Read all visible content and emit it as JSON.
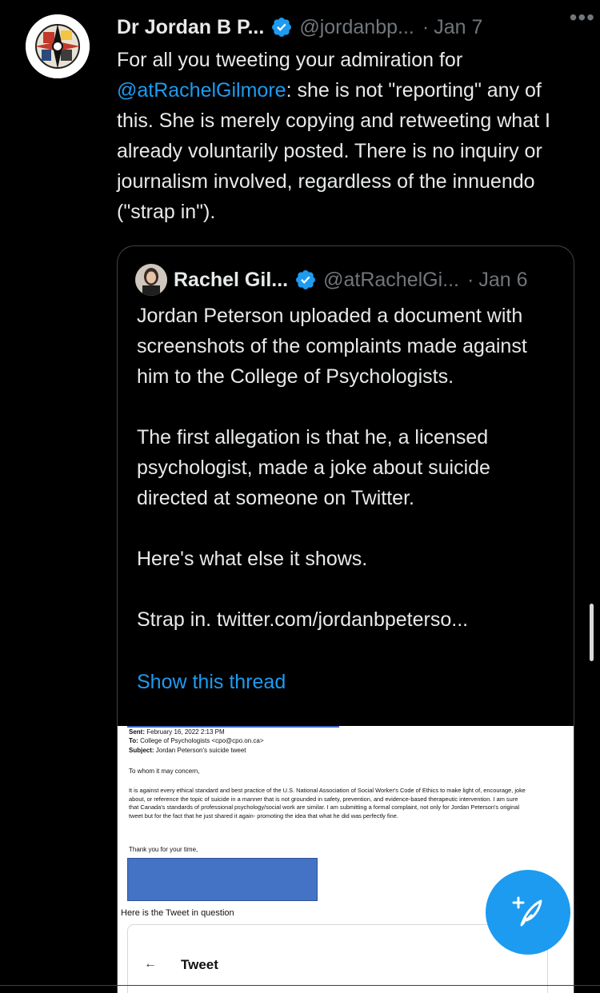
{
  "tweet": {
    "author_name": "Dr Jordan B P...",
    "author_handle": "@jordanbp...",
    "separator": "·",
    "date": "Jan 7",
    "more_label": "•••",
    "text_before_mention": "For all you tweeting your admiration for ",
    "mention": "@atRachelGilmore",
    "text_after_mention": ": she is not \"reporting\" any of this. She is merely copying and retweeting what I already voluntarily posted. There is no inquiry or journalism involved, regardless of the innuendo (\"strap in\")."
  },
  "quote": {
    "author_name": "Rachel Gil...",
    "author_handle": "@atRachelGi...",
    "separator": "·",
    "date": "Jan 6",
    "paragraphs": [
      "Jordan Peterson uploaded a document with screenshots of the complaints made against him to the College of Psychologists.",
      "The first allegation is that he, a licensed psychologist, made a joke about suicide directed at someone on Twitter.",
      "Here's what else it shows.",
      "Strap in.  twitter.com/jordanbpeterso..."
    ],
    "show_thread": "Show this thread"
  },
  "document": {
    "sent_label": "Sent:",
    "sent_value": "February 16, 2022 2:13 PM",
    "to_label": "To:",
    "to_value": "College of Psychologists <cpo@cpo.on.ca>",
    "subject_label": "Subject:",
    "subject_value": "Jordan Peterson's suicide tweet",
    "greeting": "To whom it may concern,",
    "body": "It is against every ethical standard and best practice of the U.S. National Association of Social Worker's Code of Ethics to make light of, encourage, joke about, or reference the topic of suicide in a manner that is not grounded in safety, prevention, and evidence-based therapeutic intervention. I am sure that Canada's standards of professional psychology/social work are similar. I am submitting a formal complaint, not only for Jordan Peterson's original tweet but for the fact that he just shared it again- promoting the idea that what he did was perfectly fine.",
    "closing": "Thank you for your time,",
    "question_label": "Here is the Tweet in question",
    "inner_back": "←",
    "inner_title": "Tweet"
  },
  "colors": {
    "background": "#000000",
    "text": "#e7e9ea",
    "muted": "#71767b",
    "accent": "#1d9bf0",
    "redaction": "#4472c4"
  },
  "icons": {
    "verified": "verified-badge-icon",
    "more": "more-icon",
    "compose": "compose-tweet-icon"
  }
}
